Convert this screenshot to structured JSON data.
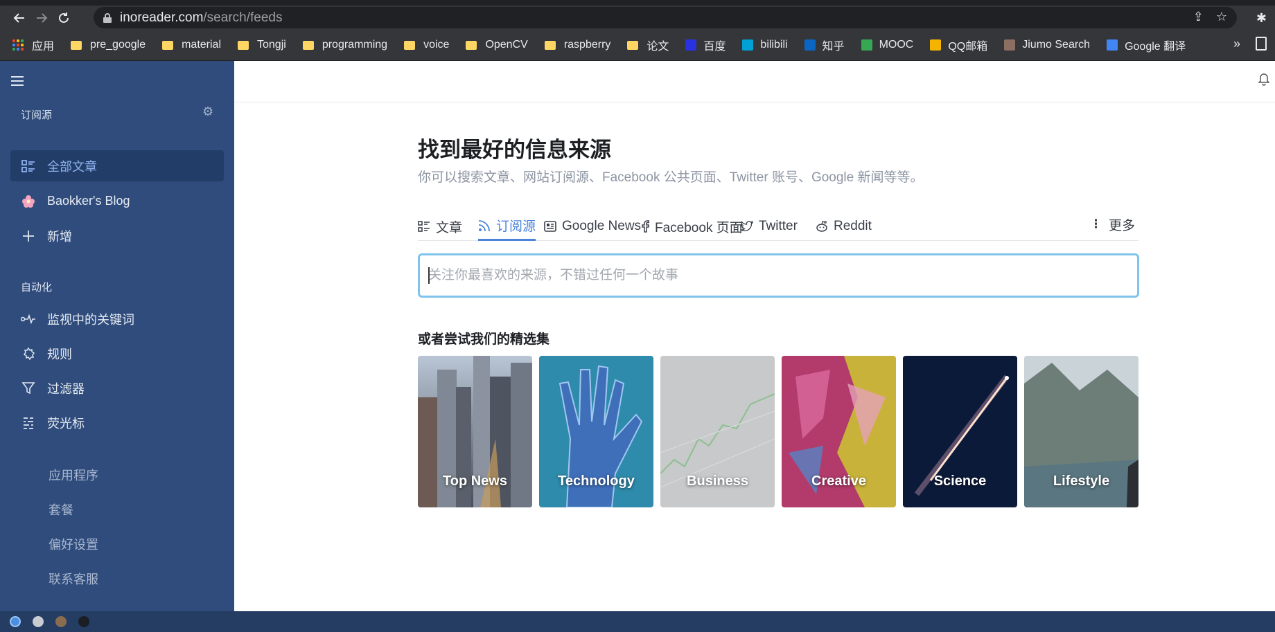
{
  "browser": {
    "url_host": "inoreader.com",
    "url_path": "/search/feeds",
    "bookmarks": [
      {
        "label": "应用",
        "type": "apps"
      },
      {
        "label": "pre_google",
        "type": "folder"
      },
      {
        "label": "material",
        "type": "folder"
      },
      {
        "label": "Tongji",
        "type": "folder"
      },
      {
        "label": "programming",
        "type": "folder"
      },
      {
        "label": "voice",
        "type": "folder"
      },
      {
        "label": "OpenCV",
        "type": "folder"
      },
      {
        "label": "raspberry",
        "type": "folder"
      },
      {
        "label": "论文",
        "type": "folder"
      },
      {
        "label": "百度",
        "type": "site",
        "color": "#2932e1"
      },
      {
        "label": "bilibili",
        "type": "site",
        "color": "#00a1d6"
      },
      {
        "label": "知乎",
        "type": "site",
        "color": "#0a66c2"
      },
      {
        "label": "MOOC",
        "type": "site",
        "color": "#36a853"
      },
      {
        "label": "QQ邮箱",
        "type": "site",
        "color": "#f4b400"
      },
      {
        "label": "Jiumo Search",
        "type": "site",
        "color": "#8d6e63"
      },
      {
        "label": "Google 翻译",
        "type": "site",
        "color": "#4285f4"
      }
    ],
    "more_label": "»"
  },
  "sidebar": {
    "feeds_section": "订阅源",
    "feeds": [
      {
        "label": "全部文章",
        "icon": "all-articles-icon",
        "active": true
      },
      {
        "label": "Baokker's Blog",
        "icon": "blog-favicon-icon",
        "active": false
      },
      {
        "label": "新增",
        "icon": "plus-icon",
        "active": false
      }
    ],
    "automation_section": "自动化",
    "automation": [
      {
        "label": "监视中的关键词",
        "icon": "keyword-monitor-icon"
      },
      {
        "label": "规则",
        "icon": "rules-icon"
      },
      {
        "label": "过滤器",
        "icon": "filter-icon"
      },
      {
        "label": "荧光标",
        "icon": "highlighter-icon"
      }
    ],
    "links": [
      "应用程序",
      "套餐",
      "偏好设置",
      "联系客服"
    ]
  },
  "main": {
    "title": "找到最好的信息来源",
    "subtitle": "你可以搜索文章、网站订阅源、Facebook 公共页面、Twitter 账号、Google 新闻等等。",
    "tabs": [
      {
        "label": "文章",
        "icon": "articles-icon",
        "active": false
      },
      {
        "label": "订阅源",
        "icon": "rss-icon",
        "active": true
      },
      {
        "label": "Google News",
        "icon": "news-icon",
        "active": false
      },
      {
        "label": "Facebook 页面",
        "icon": "facebook-icon",
        "active": false
      },
      {
        "label": "Twitter",
        "icon": "twitter-icon",
        "active": false
      },
      {
        "label": "Reddit",
        "icon": "reddit-icon",
        "active": false
      }
    ],
    "more_label": "更多",
    "search_placeholder": "关注你最喜欢的来源，不错过任何一个故事",
    "collections_title": "或者尝试我们的精选集",
    "collections": [
      {
        "label": "Top News",
        "bg": "#6b6f7a"
      },
      {
        "label": "Technology",
        "bg": "#2a7fa8"
      },
      {
        "label": "Business",
        "bg": "#b9bcbf"
      },
      {
        "label": "Creative",
        "bg": "#a8355e"
      },
      {
        "label": "Science",
        "bg": "#0c1a3a"
      },
      {
        "label": "Lifestyle",
        "bg": "#6e8690"
      }
    ]
  }
}
